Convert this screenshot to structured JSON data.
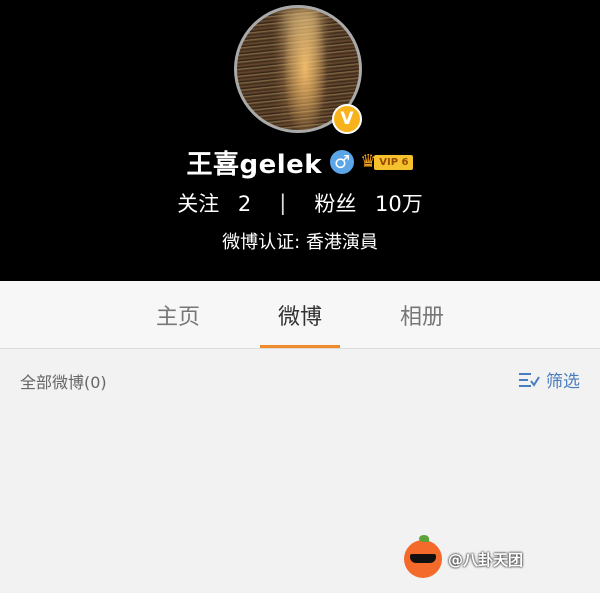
{
  "profile": {
    "name": "王喜gelek",
    "verified_badge": "V",
    "gender_symbol": "♂",
    "vip_crown": "♛",
    "vip_label": "VIP 6",
    "follow_label": "关注",
    "follow_count": "2",
    "separator": "|",
    "fans_label": "粉丝",
    "fans_count": "10万",
    "certification": "微博认证: 香港演員"
  },
  "tabs": [
    {
      "label": "主页",
      "active": false
    },
    {
      "label": "微博",
      "active": true
    },
    {
      "label": "相册",
      "active": false
    }
  ],
  "feed": {
    "all_label": "全部微博(0)",
    "filter_label": "筛选"
  },
  "watermark": {
    "text": "@八卦天团"
  },
  "colors": {
    "header_bg": "#000000",
    "active_tab_underline": "#f08b2c",
    "link_blue": "#4a7dbf",
    "verified_gold": "#f7b21c",
    "gender_blue": "#5aa6e8"
  }
}
